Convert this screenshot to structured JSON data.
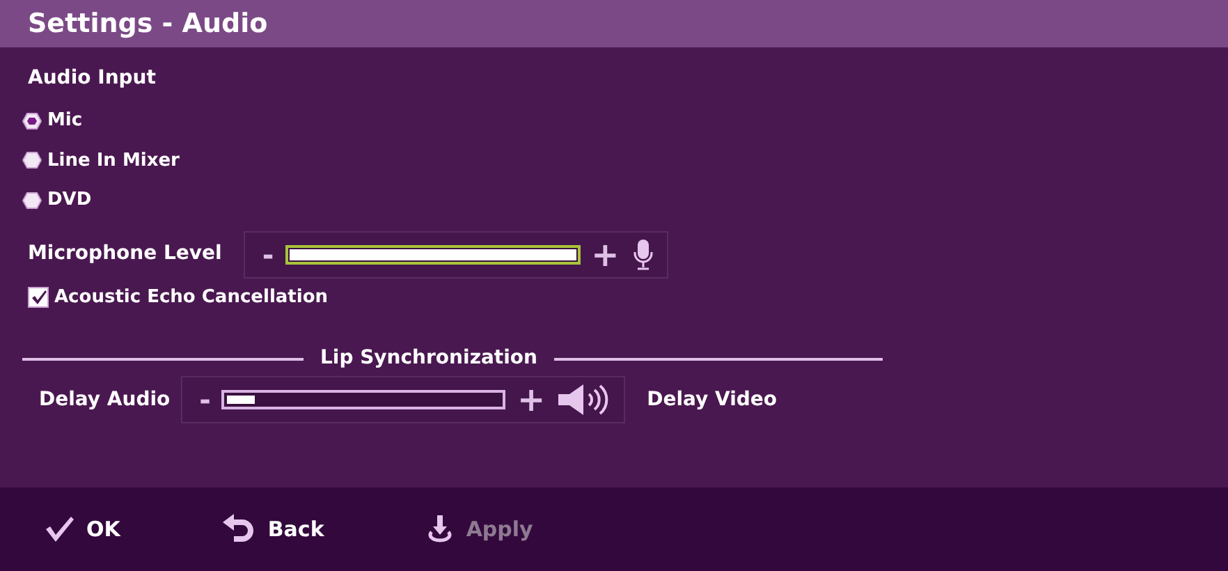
{
  "window": {
    "title": "Settings - Audio"
  },
  "audio_input": {
    "heading": "Audio Input",
    "options": [
      {
        "label": "Mic",
        "selected": true
      },
      {
        "label": "Line In Mixer",
        "selected": false
      },
      {
        "label": "DVD",
        "selected": false
      }
    ]
  },
  "microphone_level": {
    "label": "Microphone Level",
    "minus": "-",
    "plus": "+",
    "level": 1.0
  },
  "echo_cancellation": {
    "label": "Acoustic Echo Cancellation",
    "checked": true
  },
  "lip_sync": {
    "heading": "Lip Synchronization",
    "left_label": "Delay Audio",
    "right_label": "Delay Video",
    "minus": "-",
    "plus": "+",
    "level": 0.1
  },
  "buttons": [
    {
      "kind": "ok",
      "label": "OK",
      "disabled": false
    },
    {
      "kind": "back",
      "label": "Back",
      "disabled": false
    },
    {
      "kind": "apply",
      "label": "Apply",
      "disabled": true
    }
  ]
}
